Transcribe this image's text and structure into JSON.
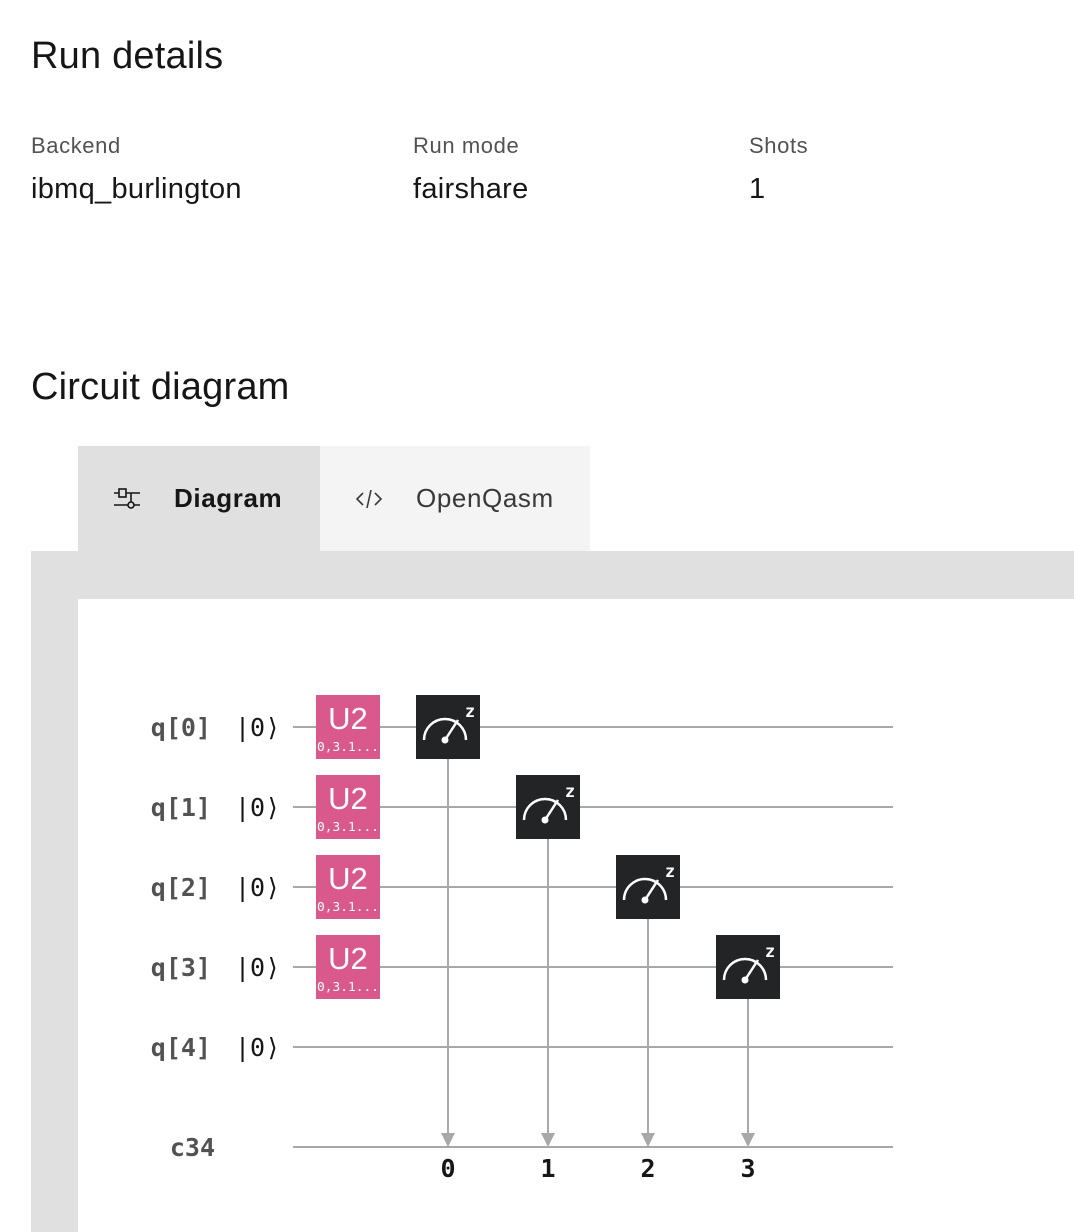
{
  "run_details": {
    "title": "Run details",
    "fields": [
      {
        "label": "Backend",
        "value": "ibmq_burlington"
      },
      {
        "label": "Run mode",
        "value": "fairshare"
      },
      {
        "label": "Shots",
        "value": "1"
      }
    ]
  },
  "circuit": {
    "title": "Circuit diagram",
    "tabs": [
      {
        "label": "Diagram",
        "icon": "circuit-diagram-icon",
        "active": true
      },
      {
        "label": "OpenQasm",
        "icon": "code-icon",
        "active": false
      }
    ],
    "qubits": [
      {
        "label": "q[0]",
        "state": "|0⟩"
      },
      {
        "label": "q[1]",
        "state": "|0⟩"
      },
      {
        "label": "q[2]",
        "state": "|0⟩"
      },
      {
        "label": "q[3]",
        "state": "|0⟩"
      },
      {
        "label": "q[4]",
        "state": "|0⟩"
      }
    ],
    "classical_register": "c34",
    "gates": [
      {
        "name": "U2",
        "params": "0,3.1...",
        "qubit": 0,
        "column": 0
      },
      {
        "name": "U2",
        "params": "0,3.1...",
        "qubit": 1,
        "column": 0
      },
      {
        "name": "U2",
        "params": "0,3.1...",
        "qubit": 2,
        "column": 0
      },
      {
        "name": "U2",
        "params": "0,3.1...",
        "qubit": 3,
        "column": 0
      }
    ],
    "measurements": [
      {
        "qubit": 0,
        "bit": "0",
        "basis": "z",
        "column": 1
      },
      {
        "qubit": 1,
        "bit": "1",
        "basis": "z",
        "column": 2
      },
      {
        "qubit": 2,
        "bit": "2",
        "basis": "z",
        "column": 3
      },
      {
        "qubit": 3,
        "bit": "3",
        "basis": "z",
        "column": 4
      }
    ],
    "colors": {
      "u2_gate": "#d9598c",
      "measure_gate": "#222426",
      "wire": "#a8a8a8",
      "qubit_label": "#525252"
    }
  }
}
